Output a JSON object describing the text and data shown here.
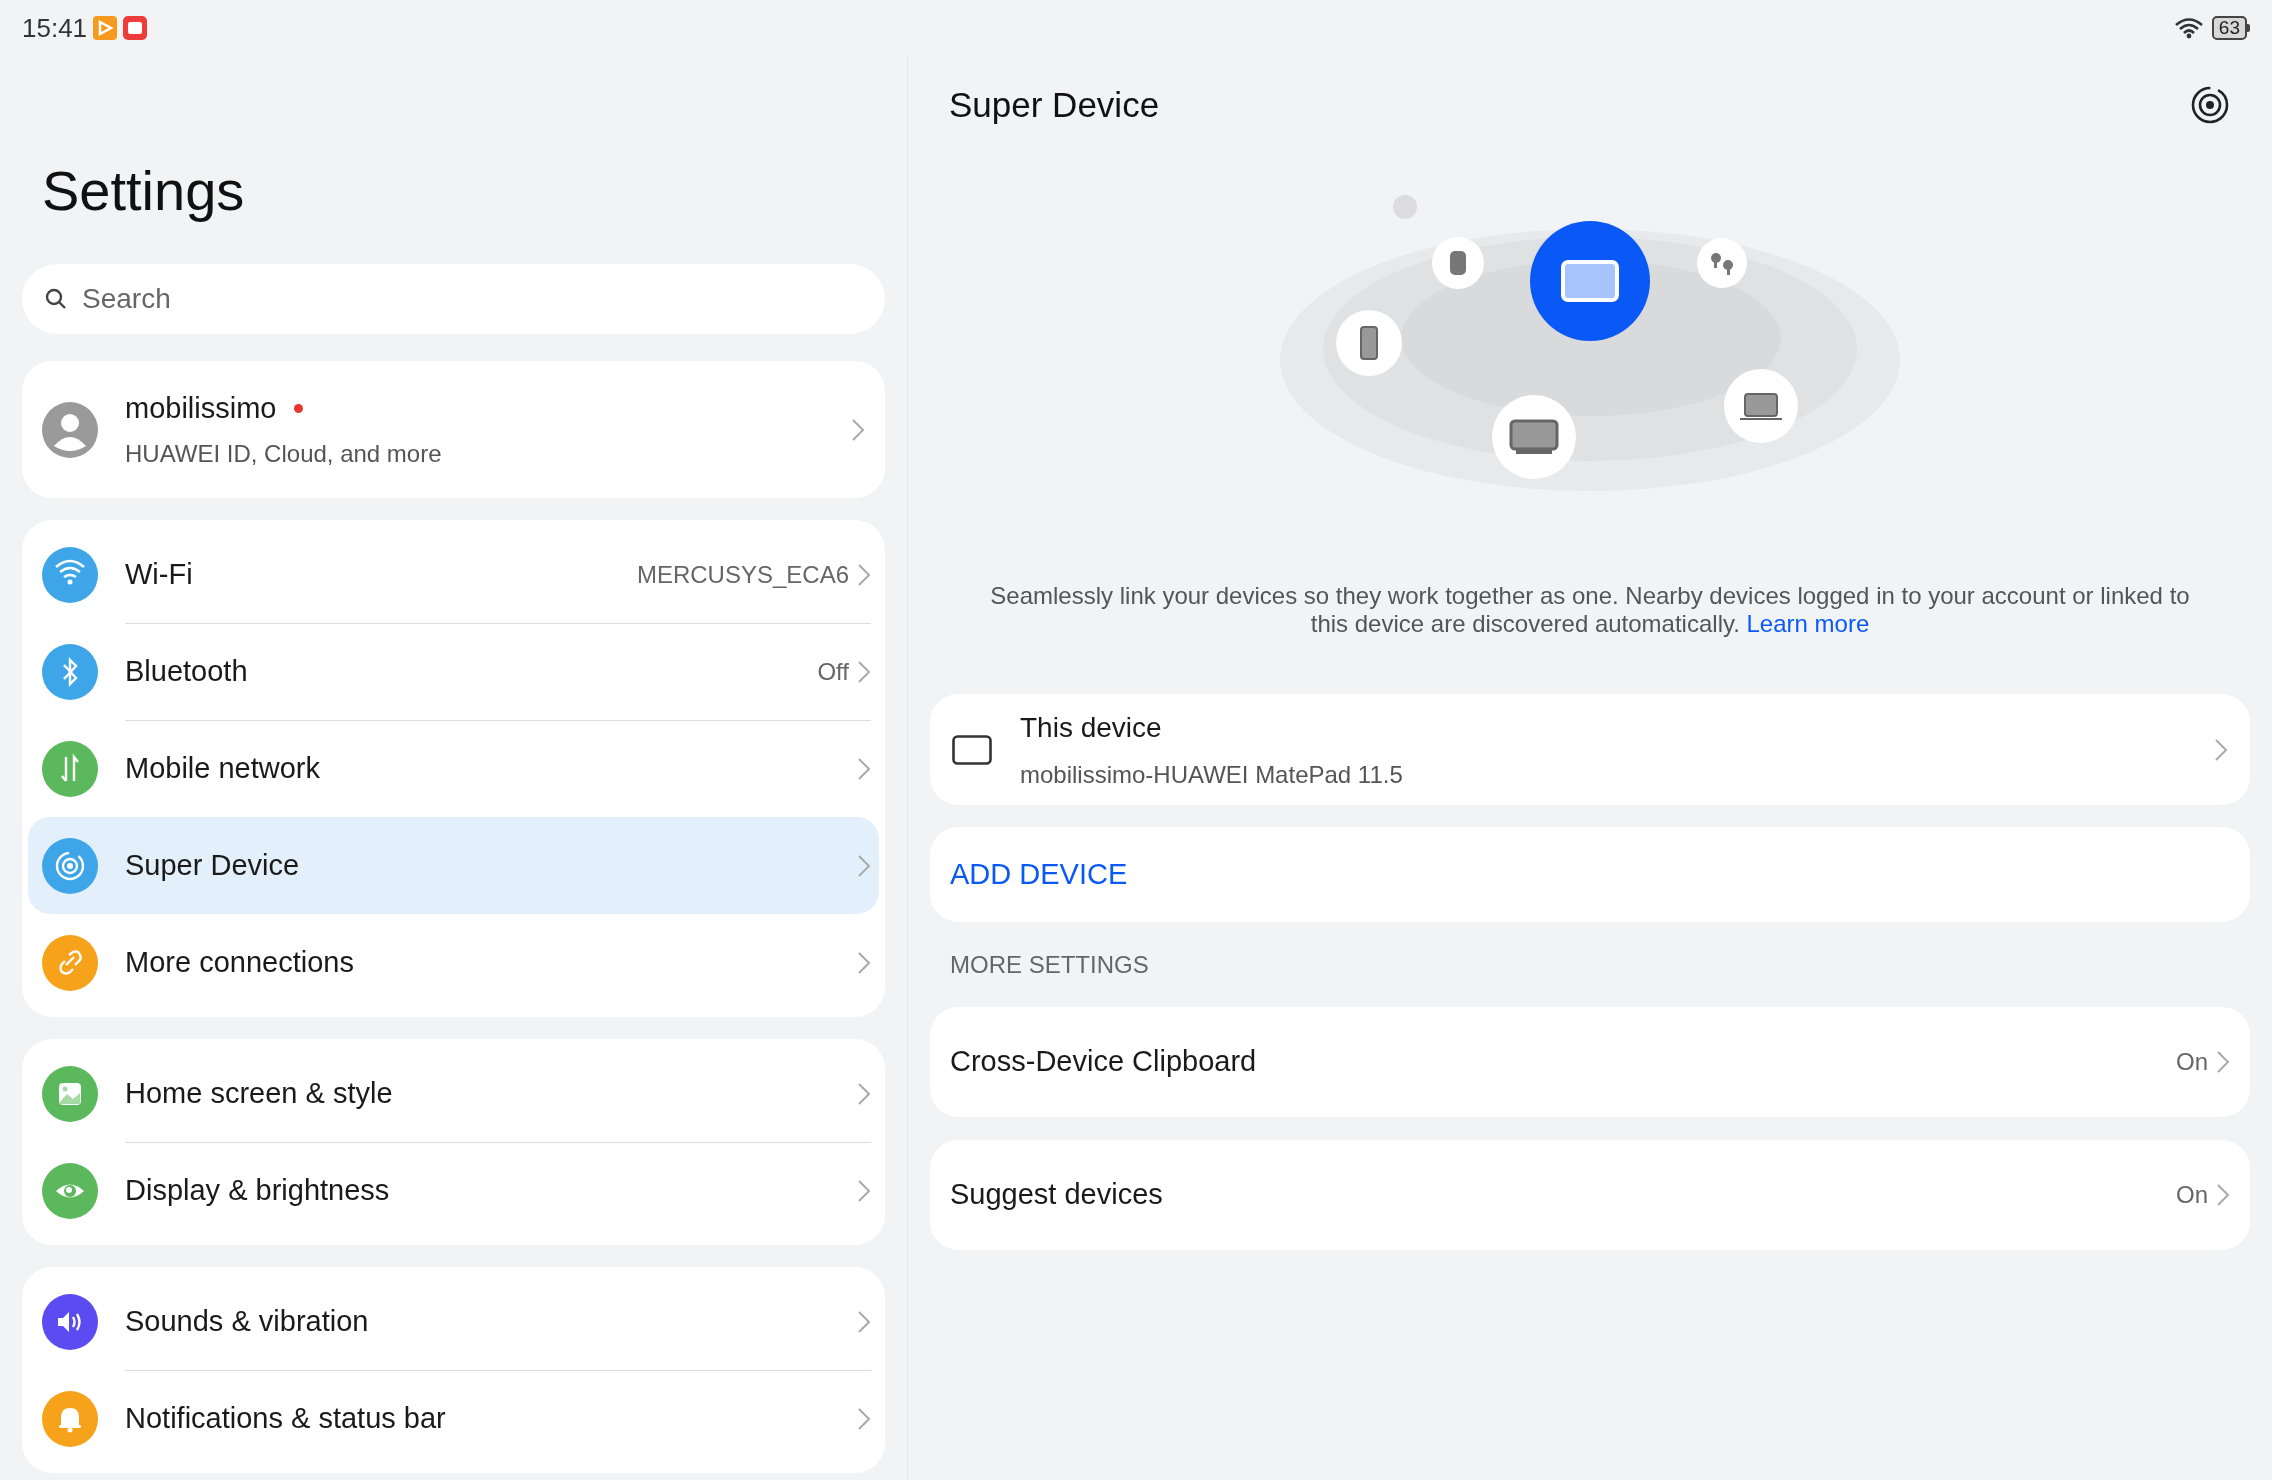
{
  "status_bar": {
    "time": "15:41",
    "battery": "63"
  },
  "settings": {
    "title": "Settings",
    "search": {
      "placeholder": "Search"
    },
    "account": {
      "name": "mobilissimo",
      "subtitle": "HUAWEI ID, Cloud, and more",
      "unread": true
    },
    "groups": [
      [
        {
          "label": "Wi-Fi",
          "value": "MERCUSYS_ECA6",
          "color": "#3ea6e8",
          "selected": false
        },
        {
          "label": "Bluetooth",
          "value": "Off",
          "color": "#3ea6e8",
          "selected": false
        },
        {
          "label": "Mobile network",
          "color": "#5cb85c",
          "selected": false
        },
        {
          "label": "Super Device",
          "color": "#3ea6e8",
          "selected": true
        },
        {
          "label": "More connections",
          "color": "#f7a21b",
          "selected": false
        }
      ],
      [
        {
          "label": "Home screen & style",
          "color": "#5cb85c",
          "selected": false
        },
        {
          "label": "Display & brightness",
          "color": "#5cb85c",
          "selected": false
        }
      ],
      [
        {
          "label": "Sounds & vibration",
          "color": "#5a4cf0",
          "selected": false
        },
        {
          "label": "Notifications & status bar",
          "color": "#f7a21b",
          "selected": false
        }
      ]
    ]
  },
  "detail": {
    "title": "Super Device",
    "description": "Seamlessly link your devices so they work together as one. Nearby devices logged in to your account or linked to this device are discovered automatically.",
    "learn_more": "Learn more",
    "this_device": {
      "title": "This device",
      "subtitle": "mobilissimo-HUAWEI MatePad 11.5"
    },
    "add_device": "ADD DEVICE",
    "more_settings_label": "MORE SETTINGS",
    "more_settings": [
      {
        "label": "Cross-Device Clipboard",
        "value": "On"
      },
      {
        "label": "Suggest devices",
        "value": "On"
      }
    ]
  }
}
